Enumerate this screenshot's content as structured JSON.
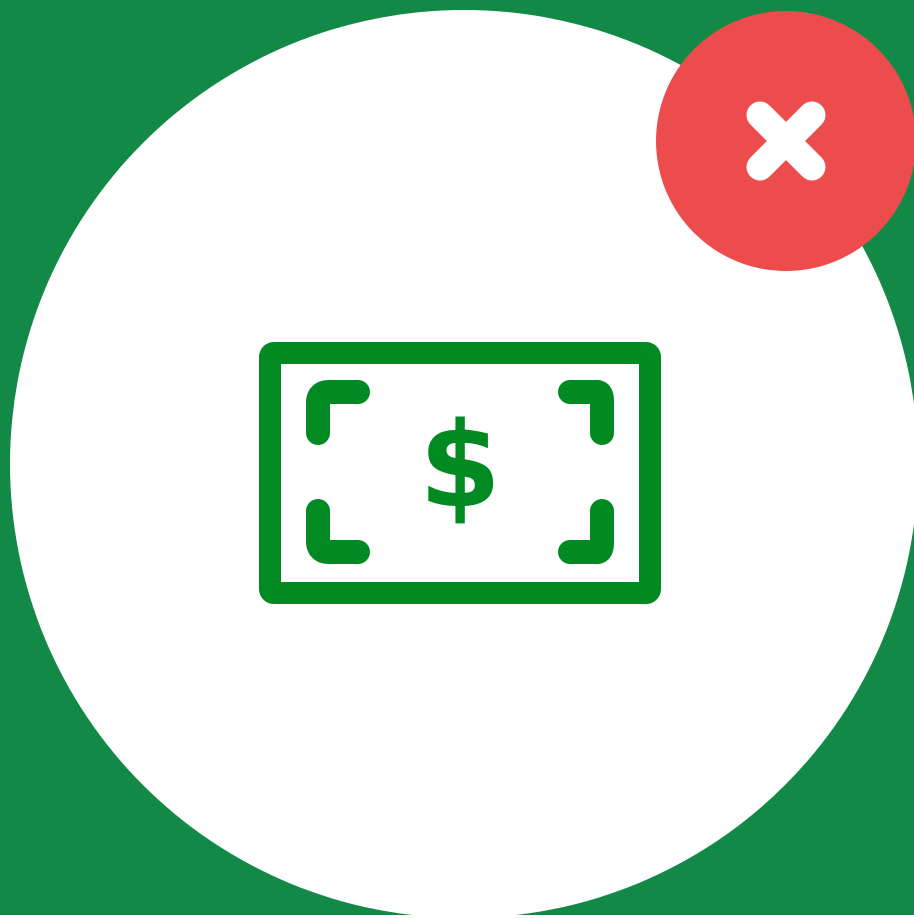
{
  "colors": {
    "background": "#128946",
    "circle": "#ffffff",
    "icon": "#028a22",
    "dismiss": "#ec4c4c",
    "dismiss_glyph": "#ffffff"
  },
  "icon": {
    "name": "dollar-bill-icon",
    "glyph": "$"
  },
  "dismiss": {
    "icon": "close-icon"
  }
}
